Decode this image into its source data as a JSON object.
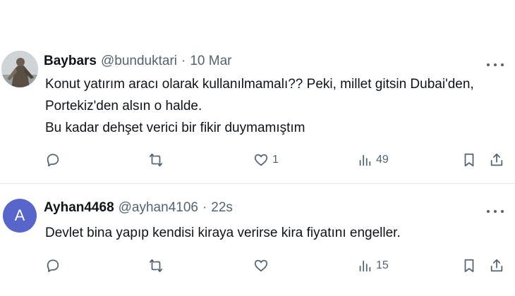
{
  "tweets": [
    {
      "avatar_type": "photo",
      "name": "Baybars",
      "handle": "@bunduktari",
      "separator": "·",
      "time": "10 Mar",
      "lines": [
        "Konut yatırım aracı olarak kullanılmamalı?? Peki, millet gitsin Dubai'den,",
        "Portekiz'den alsın o halde.",
        "Bu kadar dehşet verici bir fikir duymamıştım"
      ],
      "actions": {
        "reply_icon": "reply-icon",
        "retweet_icon": "retweet-icon",
        "like_icon": "heart-icon",
        "like_count": "1",
        "views_icon": "views-icon",
        "views_count": "49",
        "bookmark_icon": "bookmark-icon",
        "share_icon": "share-icon"
      }
    },
    {
      "avatar_type": "letter",
      "avatar_letter": "A",
      "avatar_color": "#5865cb",
      "name": "Ayhan4468",
      "handle": "@ayhan4106",
      "separator": "·",
      "time": "22s",
      "lines": [
        "Devlet bina yapıp kendisi kiraya verirse kira fiyatını engeller."
      ],
      "actions": {
        "reply_icon": "reply-icon",
        "retweet_icon": "retweet-icon",
        "like_icon": "heart-icon",
        "like_count": "",
        "views_icon": "views-icon",
        "views_count": "15",
        "bookmark_icon": "bookmark-icon",
        "share_icon": "share-icon"
      }
    }
  ],
  "colors": {
    "text": "#0f1419",
    "secondary": "#536471",
    "divider": "#e6e9ec"
  }
}
